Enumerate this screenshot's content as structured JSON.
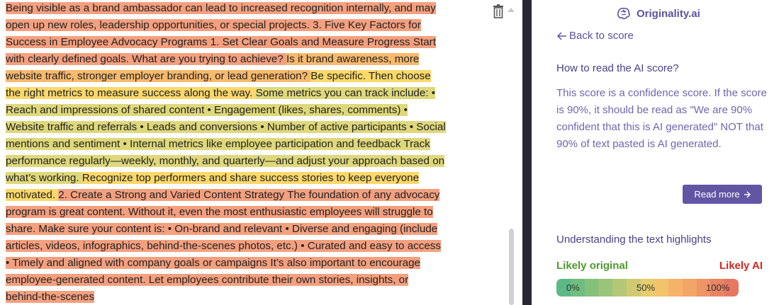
{
  "document": {
    "segments": [
      {
        "text": "Being visible as a brand ambassador can lead to increased recognition internally, and may open up new roles, leadership opportunities, or special projects. 3. Five Key Factors for Success in Employee Advocacy Programs 1. Set Clear Goals and Measure Progress Start with clearly defined goals. What are you trying to achieve? ",
        "level": "red"
      },
      {
        "text": "Is it brand awareness, more website traffic, stronger employer branding, or lead generation? ",
        "level": "orange"
      },
      {
        "text": "Be specific. Then choose the right metrics to measure success along the way. ",
        "level": "yellow"
      },
      {
        "text": "Some metrics you can track include: • Reach and impressions of shared content • Engagement (likes, shares, comments) • Website traffic and referrals • Leads and conversions • Number of active participants • Social mentions and sentiment • Internal metrics like employee participation and feedback Track performance regularly—weekly, monthly, and quarterly—and adjust your approach based on what’s working. ",
        "level": "lime"
      },
      {
        "text": "Recognize top performers and share success stories to keep everyone motivated. ",
        "level": "yellow"
      },
      {
        "text": "2. Create a Strong and Varied Content Strategy The foundation of any advocacy program is great content. Without it, even the most enthusiastic employees will struggle to share. Make sure your content is: • On-brand and relevant • Diverse and engaging (include articles, videos, infographics, behind-the-scenes photos, etc.) • Curated and easy to access • Timely and aligned with company goals or campaigns It’s also important to encourage employee-generated content. Let employees contribute their own stories, insights, or behind-the-scenes",
        "level": "red"
      }
    ],
    "highlight_colors": {
      "red": "#f4a07f",
      "orange": "#f7b96d",
      "yellow": "#fbd86a",
      "lime": "#dfd87b"
    }
  },
  "toolbar": {
    "delete_icon": "trash-icon"
  },
  "panel": {
    "brand_name": "Originality.ai",
    "brand_icon": "brain-icon",
    "back_label": "Back to score",
    "help_heading": "How to read the AI score?",
    "help_body": "This score is a confidence score. If the score is 90%, it should be read as \"We are 90% confident that this is AI generated\" NOT that 90% of text pasted is AI generated.",
    "read_more_label": "Read more",
    "highlights_heading": "Understanding the text highlights",
    "likely_original": "Likely original",
    "likely_ai": "Likely AI",
    "scale_labels": [
      "0%",
      "50%",
      "100%"
    ],
    "scale_colors": [
      "#5cb985",
      "#6fbd7f",
      "#84c17b",
      "#9ac479",
      "#b4c776",
      "#cfca72",
      "#e7cc6e",
      "#f3c36c",
      "#f5b36a",
      "#f3a467",
      "#ef9464",
      "#e98463",
      "#e57763"
    ]
  },
  "colors": {
    "accent": "#5b52a3",
    "button": "#6255a4",
    "divider": "#2b2737",
    "likely_original": "#4e9a2b",
    "likely_ai": "#d4271f"
  }
}
